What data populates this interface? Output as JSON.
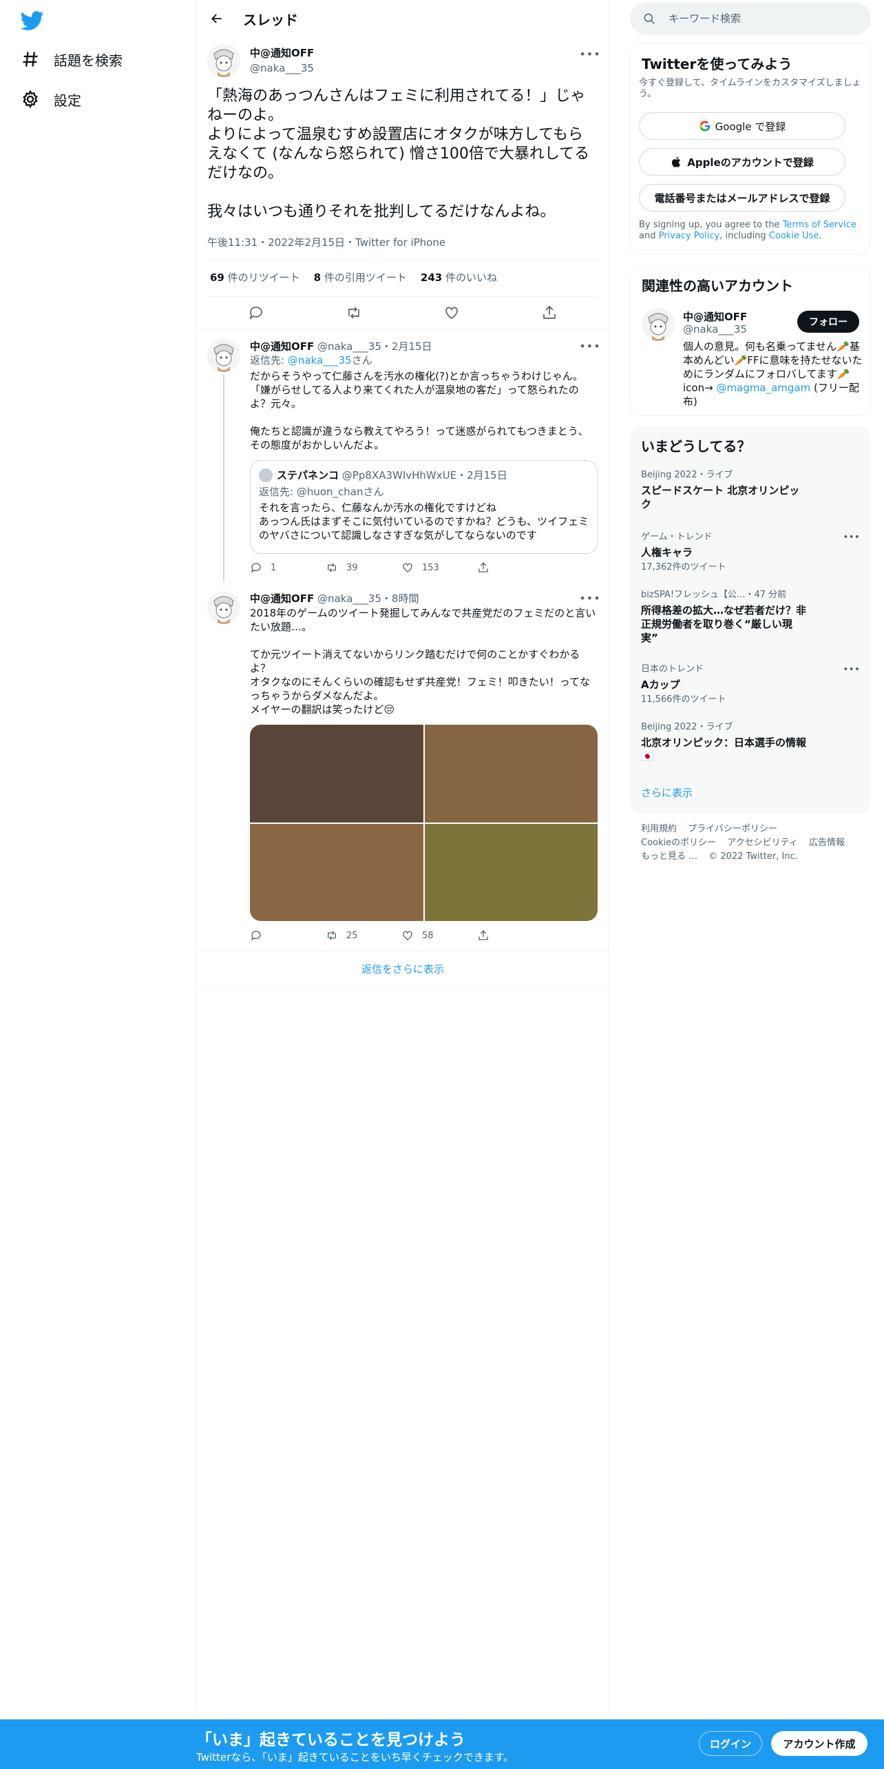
{
  "colors": {
    "brand": "#1d9bf0",
    "text": "#0f1419",
    "secondary": "#536471"
  },
  "nav": {
    "logo_icon": "twitter-bird-icon",
    "items": [
      {
        "icon": "hashtag-icon",
        "label": "話題を検索"
      },
      {
        "icon": "gear-icon",
        "label": "設定"
      }
    ]
  },
  "header": {
    "title": "スレッド"
  },
  "focal": {
    "name": "中@通知OFF",
    "handle": "@naka___35",
    "text": "「熱海のあっつんさんはフェミに利用されてる！」じゃねーのよ。\nよりによって温泉むすめ設置店にオタクが味方してもらえなくて (なんなら怒られて) 憎さ100倍で大暴れしてるだけなの。\n\n我々はいつも通りそれを批判してるだけなんよね。",
    "meta": "午後11:31・2022年2月15日・Twitter for iPhone",
    "stats": {
      "retweets": "69",
      "retweets_label": "件のリツイート",
      "quotes": "8",
      "quotes_label": "件の引用ツイート",
      "likes": "243",
      "likes_label": "件のいいね"
    }
  },
  "replies": [
    {
      "name": "中@通知OFF",
      "meta": "@naka___35・2月15日",
      "replyto_prefix": "返信先: ",
      "replyto_handle": "@naka___35",
      "replyto_suffix": "さん",
      "text": "だからそうやって仁藤さんを汚水の権化(?)とか言っちゃうわけじゃん。「嫌がらせしてる人より来てくれた人が温泉地の客だ」って怒られたのよ？元々。\n\n俺たちと認識が違うなら教えてやろう！って迷惑がられてもつきまとう、その態度がおかしいんだよ。",
      "quote": {
        "name": "ステパネンコ",
        "meta": "@Pp8XA3WIvHhWxUE・2月15日",
        "replyto": "返信先: @huon_chanさん",
        "text": "それを言ったら、仁藤なんか汚水の権化ですけどね\nあっつん氏はまずそこに気付いているのですかね？どうも、ツイフェミのヤバさについて認識しなさすぎな気がしてならないのです"
      },
      "counts": {
        "reply": "1",
        "retweet": "39",
        "like": "153"
      }
    },
    {
      "name": "中@通知OFF",
      "meta": "@naka___35・8時間",
      "text": "2018年のゲームのツイート発掘してみんなで共産党だのフェミだのと言いたい放題…。\n\nてか元ツイート消えてないからリンク踏むだけで何のことかすぐわかるよ？\nオタクなのにそんくらいの確認もせず共産党！フェミ！叩きたい！ってなっちゃうからダメなんだよ。\nメイヤーの翻訳は笑ったけど😔",
      "media_colors": [
        "#5a4639",
        "#866543",
        "#8a6744",
        "#7b7539"
      ],
      "counts": {
        "reply": "",
        "retweet": "25",
        "like": "58"
      }
    }
  ],
  "show_more_replies": "返信をさらに表示",
  "search": {
    "placeholder": "キーワード検索"
  },
  "signup": {
    "title": "Twitterを使ってみよう",
    "desc": "今すぐ登録して、タイムラインをカスタマイズしましょう。",
    "google": "Google で登録",
    "apple": "Appleのアカウントで登録",
    "phone": "電話番号またはメールアドレスで登録",
    "legal_1": "By signing up, you agree to the ",
    "legal_tos": "Terms of Service",
    "legal_2": " and ",
    "legal_privacy": "Privacy Policy",
    "legal_3": ", including ",
    "legal_cookie": "Cookie Use",
    "legal_4": "."
  },
  "related": {
    "title": "関連性の高いアカウント",
    "name": "中@通知OFF",
    "handle": "@naka___35",
    "follow": "フォロー",
    "bio_1": "個人の意見。何も名乗ってません🥕基本めんどい🥕FFに意味を持たせないためにランダムにフォロバしてます🥕icon→ ",
    "bio_link": "@magma_amgam",
    "bio_2": " (フリー配布)"
  },
  "trends": {
    "title": "いまどうしてる？",
    "items": [
      {
        "context": "Beijing 2022・ライブ",
        "title": "スピードスケート 北京オリンピック",
        "count": ""
      },
      {
        "context": "ゲーム・トレンド",
        "title": "人権キャラ",
        "count": "17,362件のツイート"
      },
      {
        "context": "bizSPA!フレッシュ【公...・47 分前",
        "title": "所得格差の拡大…なぜ若者だけ？非正規労働者を取り巻く“厳しい現実”",
        "count": ""
      },
      {
        "context": "日本のトレンド",
        "title": "Aカップ",
        "count": "11,566件のツイート"
      },
      {
        "context": "Beijing 2022・ライブ",
        "title": "北京オリンピック：日本選手の情報 🇯🇵",
        "count": ""
      }
    ],
    "more": "さらに表示"
  },
  "footer": {
    "links": [
      "利用規約",
      "プライバシーポリシー",
      "Cookieのポリシー",
      "アクセシビリティ",
      "広告情報",
      "もっと見る …"
    ],
    "copyright": "© 2022 Twitter, Inc."
  },
  "bottombar": {
    "title": "「いま」起きていることを見つけよう",
    "subtitle": "Twitterなら、「いま」起きていることをいち早くチェックできます。",
    "login": "ログイン",
    "signup": "アカウント作成"
  }
}
